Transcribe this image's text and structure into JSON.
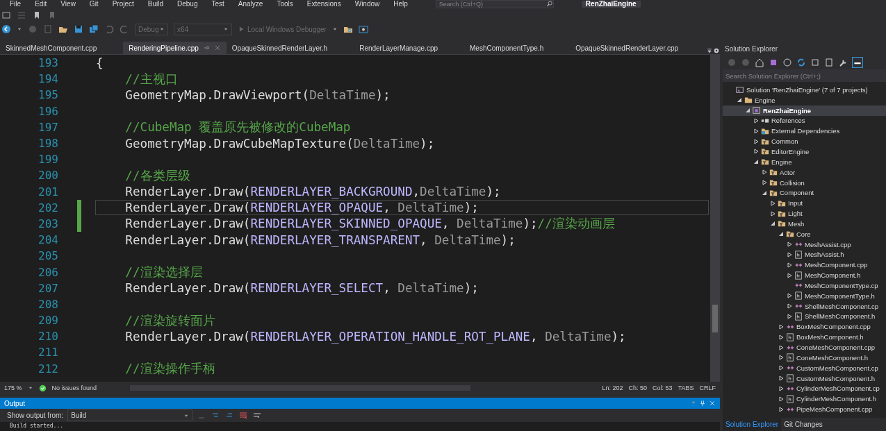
{
  "menu": [
    "File",
    "Edit",
    "View",
    "Git",
    "Project",
    "Build",
    "Debug",
    "Test",
    "Analyze",
    "Tools",
    "Extensions",
    "Window",
    "Help"
  ],
  "search": {
    "placeholder": "Search (Ctrl+Q)"
  },
  "window": {
    "title": "RenZhaiEngine"
  },
  "toolbar": {
    "configuration": "Debug",
    "platform": "x64",
    "debugger": "Local Windows Debugger"
  },
  "tabs": [
    {
      "label": "SkinnedMeshComponent.cpp",
      "selected": false
    },
    {
      "label": "RenderingPipeline.cpp",
      "selected": true
    },
    {
      "label": "OpaqueSkinnedRenderLayer.h",
      "selected": false
    },
    {
      "label": "RenderLayerManage.cpp",
      "selected": false
    },
    {
      "label": "MeshComponentType.h",
      "selected": false
    },
    {
      "label": "OpaqueSkinnedRenderLayer.cpp",
      "selected": false
    }
  ],
  "editor": {
    "lines": [
      {
        "number": "193",
        "current": false,
        "changed": false,
        "tokens": [
          {
            "kind": "text",
            "text": "{"
          }
        ]
      },
      {
        "number": "194",
        "current": false,
        "changed": false,
        "tokens": [
          {
            "kind": "comment",
            "text": "    //主视口"
          }
        ]
      },
      {
        "number": "195",
        "current": false,
        "changed": false,
        "tokens": [
          {
            "kind": "text",
            "text": "    GeometryMap.DrawViewport("
          },
          {
            "kind": "param",
            "text": "DeltaTime"
          },
          {
            "kind": "text",
            "text": ");"
          }
        ]
      },
      {
        "number": "196",
        "current": false,
        "changed": false
      },
      {
        "number": "197",
        "current": false,
        "changed": false,
        "tokens": [
          {
            "kind": "comment",
            "text": "    //CubeMap 覆盖原先被修改的CubeMap"
          }
        ]
      },
      {
        "number": "198",
        "current": false,
        "changed": false,
        "tokens": [
          {
            "kind": "text",
            "text": "    GeometryMap.DrawCubeMapTexture("
          },
          {
            "kind": "param",
            "text": "DeltaTime"
          },
          {
            "kind": "text",
            "text": ");"
          }
        ]
      },
      {
        "number": "199",
        "current": false,
        "changed": false
      },
      {
        "number": "200",
        "current": false,
        "changed": false,
        "tokens": [
          {
            "kind": "comment",
            "text": "    //各类层级"
          }
        ]
      },
      {
        "number": "201",
        "current": false,
        "changed": false,
        "tokens": [
          {
            "kind": "text",
            "text": "    RenderLayer.Draw("
          },
          {
            "kind": "macro",
            "text": "RENDERLAYER_BACKGROUND"
          },
          {
            "kind": "text",
            "text": ","
          },
          {
            "kind": "param",
            "text": "DeltaTime"
          },
          {
            "kind": "text",
            "text": ");"
          }
        ]
      },
      {
        "number": "202",
        "current": true,
        "changed": true,
        "tokens": [
          {
            "kind": "text",
            "text": "    RenderLayer.Draw("
          },
          {
            "kind": "macro",
            "text": "RENDERLAYER_OPAQUE"
          },
          {
            "kind": "text",
            "text": ", "
          },
          {
            "kind": "param",
            "text": "DeltaTime"
          },
          {
            "kind": "text",
            "text": ");"
          }
        ]
      },
      {
        "number": "203",
        "current": false,
        "changed": true,
        "tokens": [
          {
            "kind": "text",
            "text": "    RenderLayer.Draw("
          },
          {
            "kind": "macro",
            "text": "RENDERLAYER_SKINNED_OPAQUE"
          },
          {
            "kind": "text",
            "text": ", "
          },
          {
            "kind": "param",
            "text": "DeltaTime"
          },
          {
            "kind": "text",
            "text": ");"
          },
          {
            "kind": "comment",
            "text": "//渲染动画层"
          }
        ]
      },
      {
        "number": "204",
        "current": false,
        "changed": false,
        "tokens": [
          {
            "kind": "text",
            "text": "    RenderLayer.Draw("
          },
          {
            "kind": "macro",
            "text": "RENDERLAYER_TRANSPARENT"
          },
          {
            "kind": "text",
            "text": ", "
          },
          {
            "kind": "param",
            "text": "DeltaTime"
          },
          {
            "kind": "text",
            "text": ");"
          }
        ]
      },
      {
        "number": "205",
        "current": false,
        "changed": false
      },
      {
        "number": "206",
        "current": false,
        "changed": false,
        "tokens": [
          {
            "kind": "comment",
            "text": "    //渲染选择层"
          }
        ]
      },
      {
        "number": "207",
        "current": false,
        "changed": false,
        "tokens": [
          {
            "kind": "text",
            "text": "    RenderLayer.Draw("
          },
          {
            "kind": "macro",
            "text": "RENDERLAYER_SELECT"
          },
          {
            "kind": "text",
            "text": ", "
          },
          {
            "kind": "param",
            "text": "DeltaTime"
          },
          {
            "kind": "text",
            "text": ");"
          }
        ]
      },
      {
        "number": "208",
        "current": false,
        "changed": false
      },
      {
        "number": "209",
        "current": false,
        "changed": false,
        "tokens": [
          {
            "kind": "comment",
            "text": "    //渲染旋转面片"
          }
        ]
      },
      {
        "number": "210",
        "current": false,
        "changed": false,
        "tokens": [
          {
            "kind": "text",
            "text": "    RenderLayer.Draw("
          },
          {
            "kind": "macro",
            "text": "RENDERLAYER_OPERATION_HANDLE_ROT_PLANE"
          },
          {
            "kind": "text",
            "text": ", "
          },
          {
            "kind": "param",
            "text": "DeltaTime"
          },
          {
            "kind": "text",
            "text": ");"
          }
        ]
      },
      {
        "number": "211",
        "current": false,
        "changed": false
      },
      {
        "number": "212",
        "current": false,
        "changed": false,
        "tokens": [
          {
            "kind": "comment",
            "text": "    //渲染操作手柄"
          }
        ]
      }
    ]
  },
  "status_bar": {
    "zoom": "175 %",
    "issues": "No issues found",
    "line": "Ln: 202",
    "char": "Ch: 50",
    "col": "Col: 53",
    "indent": "TABS",
    "eol": "CRLF"
  },
  "output": {
    "title": "Output",
    "source_label": "Show output from:",
    "source": "Build",
    "text": "Build started..."
  },
  "solution_explorer": {
    "title": "Solution Explorer",
    "search": {
      "placeholder": "Search Solution Explorer (Ctrl+;)"
    },
    "tree": [
      {
        "label": "Solution 'RenZhaiEngine' (7 of 7 projects)",
        "kind": "solution",
        "children": [
          {
            "label": "Engine",
            "kind": "folder",
            "expanded": true,
            "children": [
              {
                "label": "RenZhaiEngine",
                "kind": "project",
                "expanded": true,
                "children": [
                  {
                    "label": "References",
                    "kind": "references",
                    "expanded": false
                  },
                  {
                    "label": "External Dependencies",
                    "kind": "deps",
                    "expanded": false
                  },
                  {
                    "label": "Common",
                    "kind": "filter",
                    "expanded": false
                  },
                  {
                    "label": "EditorEngine",
                    "kind": "filter",
                    "expanded": false
                  },
                  {
                    "label": "Engine",
                    "kind": "filter",
                    "expanded": true,
                    "children": [
                      {
                        "label": "Actor",
                        "kind": "filter",
                        "expanded": false
                      },
                      {
                        "label": "Collision",
                        "kind": "filter",
                        "expanded": false
                      },
                      {
                        "label": "Component",
                        "kind": "filter",
                        "expanded": true,
                        "children": [
                          {
                            "label": "Input",
                            "kind": "filter",
                            "expanded": false
                          },
                          {
                            "label": "Light",
                            "kind": "filter",
                            "expanded": false
                          },
                          {
                            "label": "Mesh",
                            "kind": "filter",
                            "expanded": true,
                            "children": [
                              {
                                "label": "Core",
                                "kind": "filter",
                                "expanded": true,
                                "children": [
                                  {
                                    "label": "MeshAssist.cpp",
                                    "kind": "cpp",
                                    "expanded": false
                                  },
                                  {
                                    "label": "MeshAssist.h",
                                    "kind": "h",
                                    "expanded": false
                                  },
                                  {
                                    "label": "MeshComponent.cpp",
                                    "kind": "cpp",
                                    "expanded": false
                                  },
                                  {
                                    "label": "MeshComponent.h",
                                    "kind": "h",
                                    "expanded": false
                                  },
                                  {
                                    "label": "MeshComponentType.cp",
                                    "kind": "cpp"
                                  },
                                  {
                                    "label": "MeshComponentType.h",
                                    "kind": "h",
                                    "expanded": false
                                  },
                                  {
                                    "label": "ShellMeshComponent.cp",
                                    "kind": "cpp",
                                    "expanded": false
                                  },
                                  {
                                    "label": "ShellMeshComponent.h",
                                    "kind": "h",
                                    "expanded": false
                                  }
                                ]
                              },
                              {
                                "label": "BoxMeshComponent.cpp",
                                "kind": "cpp",
                                "expanded": false
                              },
                              {
                                "label": "BoxMeshComponent.h",
                                "kind": "h",
                                "expanded": false
                              },
                              {
                                "label": "ConeMeshComponent.cpp",
                                "kind": "cpp",
                                "expanded": false
                              },
                              {
                                "label": "ConeMeshComponent.h",
                                "kind": "h",
                                "expanded": false
                              },
                              {
                                "label": "CustomMeshComponent.cp",
                                "kind": "cpp",
                                "expanded": false
                              },
                              {
                                "label": "CustomMeshComponent.h",
                                "kind": "h",
                                "expanded": false
                              },
                              {
                                "label": "CylinderMeshComponent.cp",
                                "kind": "cpp",
                                "expanded": false
                              },
                              {
                                "label": "CylinderMeshComponent.h",
                                "kind": "h",
                                "expanded": false
                              },
                              {
                                "label": "PipeMeshComponent.cpp",
                                "kind": "cpp",
                                "expanded": false
                              }
                            ]
                          }
                        ]
                      }
                    ]
                  }
                ]
              }
            ]
          }
        ]
      }
    ]
  },
  "bottom_tabs": [
    {
      "label": "Solution Explorer",
      "selected": true
    },
    {
      "label": "Git Changes",
      "selected": false
    }
  ]
}
